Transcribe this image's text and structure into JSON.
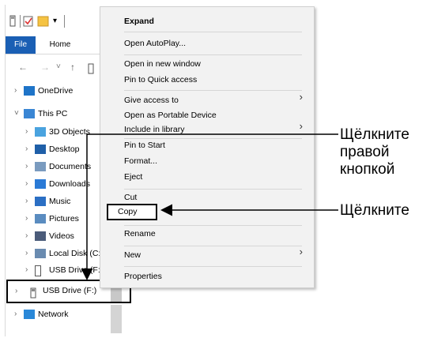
{
  "ribbon": {
    "tabs": [
      "File",
      "Home"
    ]
  },
  "nav": {
    "back_icon": "back-arrow-icon",
    "forward_icon": "forward-arrow-icon",
    "recent_icon": "chevron-down-icon",
    "up_icon": "up-arrow-icon"
  },
  "tree": {
    "items": [
      {
        "label": "OneDrive",
        "icon": "cloud-icon"
      },
      {
        "label": "This PC",
        "icon": "pc-icon"
      },
      {
        "label": "3D Objects",
        "icon": "3d-objects-icon"
      },
      {
        "label": "Desktop",
        "icon": "desktop-icon"
      },
      {
        "label": "Documents",
        "icon": "documents-icon"
      },
      {
        "label": "Downloads",
        "icon": "downloads-icon"
      },
      {
        "label": "Music",
        "icon": "music-icon"
      },
      {
        "label": "Pictures",
        "icon": "pictures-icon"
      },
      {
        "label": "Videos",
        "icon": "videos-icon"
      },
      {
        "label": "Local Disk (C:)",
        "icon": "local-disk-icon"
      },
      {
        "label": "USB Drive (F:)",
        "icon": "usb-drive-icon"
      },
      {
        "label": "USB Drive (F:)",
        "icon": "usb-drive-icon"
      },
      {
        "label": "Network",
        "icon": "network-icon"
      }
    ]
  },
  "context_menu": {
    "items": [
      {
        "label": "Expand",
        "bold": true
      },
      {
        "label": "Open AutoPlay..."
      },
      {
        "label": "Open in new window"
      },
      {
        "label": "Pin to Quick access"
      },
      {
        "label": "Give access to",
        "submenu": true
      },
      {
        "label": "Open as Portable Device"
      },
      {
        "label": "Include in library",
        "submenu": true
      },
      {
        "label": "Pin to Start"
      },
      {
        "label": "Format..."
      },
      {
        "label": "Eject"
      },
      {
        "label": "Cut"
      },
      {
        "label": "Copy"
      },
      {
        "label": "Rename"
      },
      {
        "label": "New",
        "submenu": true
      },
      {
        "label": "Properties"
      }
    ]
  },
  "callouts": {
    "right_click_line1": "Щёлкните",
    "right_click_line2": "правой",
    "right_click_line3": "кнопкой",
    "click": "Щёлкните"
  },
  "colors": {
    "file_tab": "#1a5fb4",
    "highlight_border": "#000000",
    "menu_bg": "#f2f2f2"
  }
}
